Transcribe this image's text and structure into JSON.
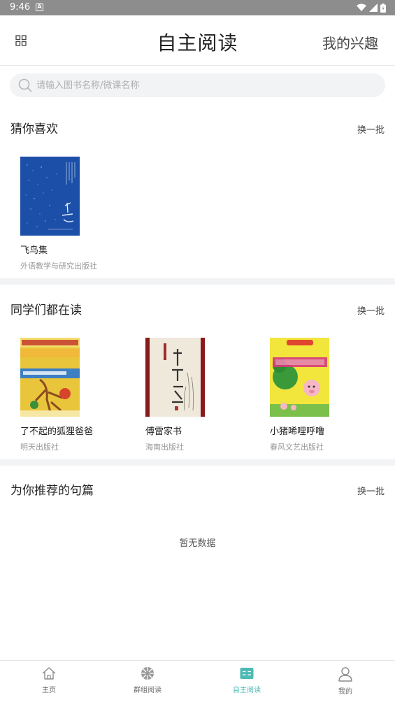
{
  "status_bar": {
    "time": "9:46"
  },
  "header": {
    "title": "自主阅读",
    "right_label": "我的兴趣"
  },
  "search": {
    "placeholder": "请输入图书名称/微课名称"
  },
  "sections": [
    {
      "title": "猜你喜欢",
      "more": "换一批",
      "books": [
        {
          "name": "飞鸟集",
          "publisher": "外语教学与研究出版社",
          "cover_color": "#1c4fa8"
        }
      ]
    },
    {
      "title": "同学们都在读",
      "more": "换一批",
      "books": [
        {
          "name": "了不起的狐狸爸爸",
          "publisher": "明天出版社",
          "cover_color": "#e9c53c"
        },
        {
          "name": "傅雷家书",
          "publisher": "海南出版社",
          "cover_color": "#efe9dc"
        },
        {
          "name": "小猪唏哩呼噜",
          "publisher": "春风文艺出版社",
          "cover_color": "#f2e53b"
        }
      ]
    },
    {
      "title": "为你推荐的句篇",
      "more": "换一批",
      "empty_text": "暂无数据"
    }
  ],
  "tabbar": {
    "items": [
      {
        "label": "主页",
        "icon": "home-icon"
      },
      {
        "label": "群组阅读",
        "icon": "group-icon"
      },
      {
        "label": "自主阅读",
        "icon": "reading-icon",
        "active": true
      },
      {
        "label": "我的",
        "icon": "profile-icon"
      }
    ],
    "active_color": "#4dbab3"
  }
}
